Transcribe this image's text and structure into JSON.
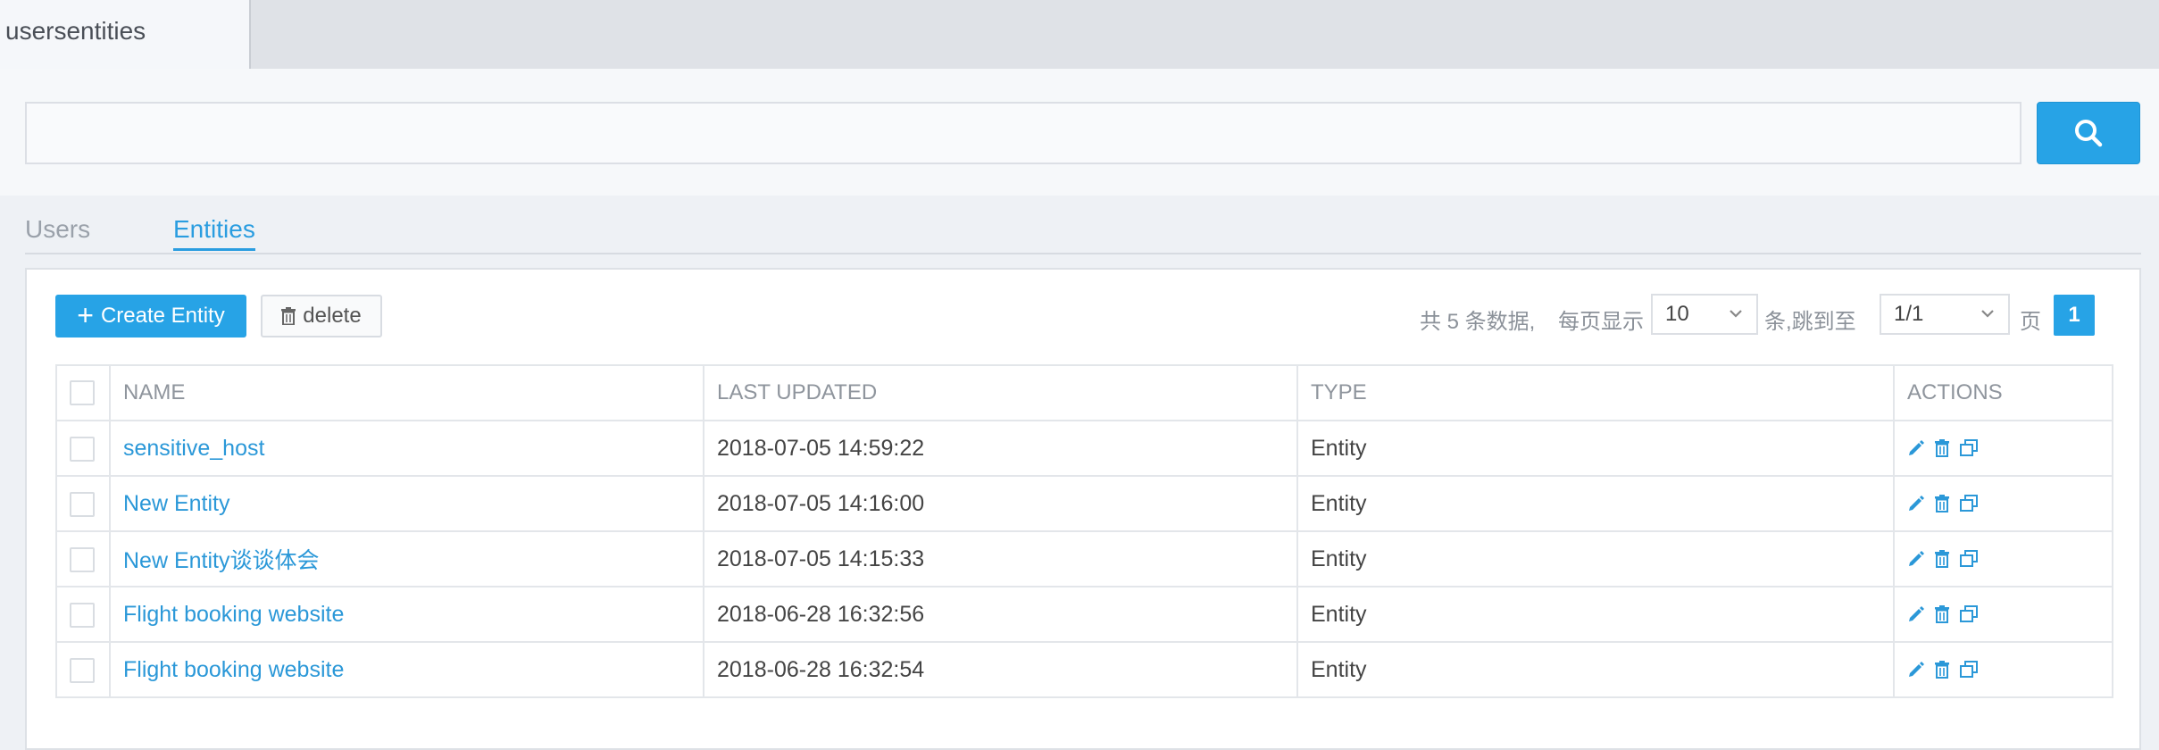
{
  "tabbar": {
    "active_tab": "usersentities"
  },
  "search": {
    "value": "",
    "placeholder": ""
  },
  "section_tabs": {
    "users": "Users",
    "entities": "Entities"
  },
  "toolbar": {
    "create_label": "Create Entity",
    "delete_label": "delete"
  },
  "pager": {
    "total_text": "共 5 条数据,",
    "per_page_label": "每页显示",
    "per_page_value": "10",
    "jump_label": "条,跳到至",
    "page_select_value": "1/1",
    "page_suffix": "页",
    "current_page": "1"
  },
  "table": {
    "columns": {
      "name": "NAME",
      "last_updated": "LAST UPDATED",
      "type": "TYPE",
      "actions": "ACTIONS"
    },
    "rows": [
      {
        "name": "sensitive_host",
        "last_updated": "2018-07-05 14:59:22",
        "type": "Entity"
      },
      {
        "name": "New Entity",
        "last_updated": "2018-07-05 14:16:00",
        "type": "Entity"
      },
      {
        "name": "New Entity谈谈体会",
        "last_updated": "2018-07-05 14:15:33",
        "type": "Entity"
      },
      {
        "name": "Flight booking website",
        "last_updated": "2018-06-28 16:32:56",
        "type": "Entity"
      },
      {
        "name": "Flight booking website",
        "last_updated": "2018-06-28 16:32:54",
        "type": "Entity"
      }
    ]
  },
  "colors": {
    "accent": "#27a3e6",
    "link": "#2b98d8"
  },
  "icons": [
    "search-icon",
    "plus-icon",
    "trash-icon",
    "edit-icon",
    "copy-icon",
    "chevron-down-icon"
  ]
}
